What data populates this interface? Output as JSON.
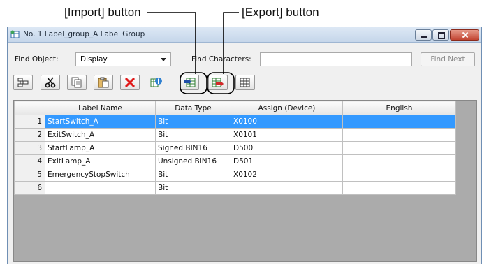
{
  "callouts": {
    "import": "[Import] button",
    "export": "[Export] button"
  },
  "window": {
    "title": "No. 1 Label_group_A Label Group"
  },
  "find": {
    "object_label": "Find Object:",
    "object_value": "Display",
    "chars_label": "Find Characters:",
    "chars_value": "",
    "next_label": "Find Next"
  },
  "toolbar": [
    {
      "name": "insert-row",
      "icon": "insert-row-icon"
    },
    {
      "name": "cut",
      "icon": "scissors-icon"
    },
    {
      "name": "copy",
      "icon": "copy-icon"
    },
    {
      "name": "paste",
      "icon": "paste-icon"
    },
    {
      "name": "delete",
      "icon": "red-x-icon"
    },
    {
      "name": "property",
      "icon": "info-icon"
    },
    {
      "name": "import",
      "icon": "import-icon"
    },
    {
      "name": "export",
      "icon": "export-icon"
    },
    {
      "name": "table-settings",
      "icon": "table-icon"
    }
  ],
  "table": {
    "headers": [
      "",
      "Label Name",
      "Data Type",
      "Assign (Device)",
      "English"
    ],
    "rows": [
      {
        "num": "1",
        "name": "StartSwitch_A",
        "type": "Bit",
        "device": "X0100",
        "english": ""
      },
      {
        "num": "2",
        "name": "ExitSwitch_A",
        "type": "Bit",
        "device": "X0101",
        "english": ""
      },
      {
        "num": "3",
        "name": "StartLamp_A",
        "type": "Signed BIN16",
        "device": "D500",
        "english": ""
      },
      {
        "num": "4",
        "name": "ExitLamp_A",
        "type": "Unsigned BIN16",
        "device": "D501",
        "english": ""
      },
      {
        "num": "5",
        "name": "EmergencyStopSwitch",
        "type": "Bit",
        "device": "X0102",
        "english": ""
      },
      {
        "num": "6",
        "name": "",
        "type": "Bit",
        "device": "",
        "english": ""
      }
    ],
    "selected_row": 1
  },
  "colors": {
    "selection": "#3399ff",
    "titlebar": "#c5d6ea"
  }
}
